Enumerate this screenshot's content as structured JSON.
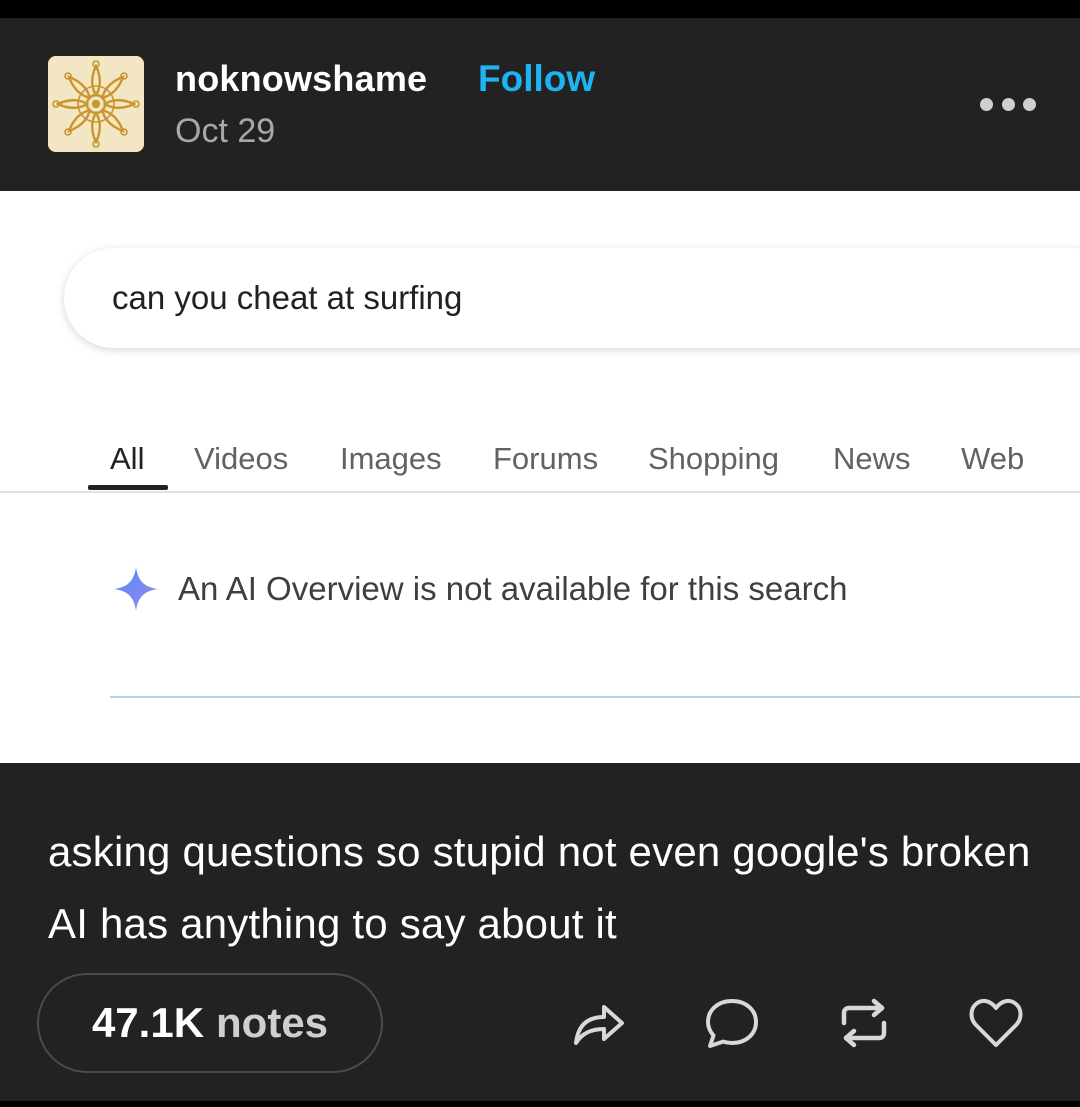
{
  "post": {
    "blog_name": "noknowshame",
    "follow_label": "Follow",
    "date": "Oct 29",
    "avatar_icon": "golden-mandala-icon",
    "more_icon": "ellipsis-icon"
  },
  "screenshot": {
    "search_query": "can you cheat at surfing",
    "tabs": [
      {
        "label": "All",
        "active": true
      },
      {
        "label": "Videos",
        "active": false
      },
      {
        "label": "Images",
        "active": false
      },
      {
        "label": "Forums",
        "active": false
      },
      {
        "label": "Shopping",
        "active": false
      },
      {
        "label": "News",
        "active": false
      },
      {
        "label": "Web",
        "active": false
      }
    ],
    "ai_notice": "An AI Overview is not available for this search",
    "sparkle_icon": "ai-sparkle-icon"
  },
  "caption": "asking questions so stupid not even google's broken AI has anything to say about it",
  "footer": {
    "notes_count": "47.1K",
    "notes_label": "notes",
    "actions": [
      "share-icon",
      "reply-icon",
      "reblog-icon",
      "like-icon"
    ]
  },
  "colors": {
    "background": "#222222",
    "follow": "#1eb3f2",
    "muted": "#a8a8a8"
  }
}
